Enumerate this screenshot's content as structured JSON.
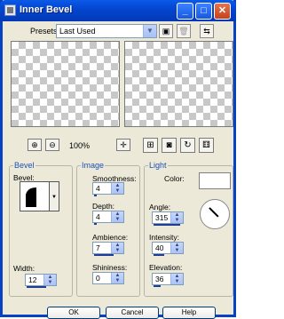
{
  "window": {
    "title": "Inner Bevel"
  },
  "title_buttons": {
    "minimize": "_",
    "maximize": "□",
    "close": "✕"
  },
  "presets": {
    "label": "Presets:",
    "value": "Last Used"
  },
  "zoom": {
    "in_icon": "zoom-in-icon",
    "out_icon": "zoom-out-icon",
    "level": "100%"
  },
  "bevel": {
    "group_title": "Bevel",
    "bevel_label": "Bevel:",
    "width_label": "Width:",
    "width_value": "12"
  },
  "image": {
    "group_title": "Image",
    "smoothness_label": "Smoothness:",
    "smoothness_value": "4",
    "depth_label": "Depth:",
    "depth_value": "4",
    "ambience_label": "Ambience:",
    "ambience_value": "7",
    "shininess_label": "Shininess:",
    "shininess_value": "0"
  },
  "light": {
    "group_title": "Light",
    "color_label": "Color:",
    "color_value": "#ffffff",
    "angle_label": "Angle:",
    "angle_value": "315",
    "intensity_label": "Intensity:",
    "intensity_value": "40",
    "elevation_label": "Elevation:",
    "elevation_value": "36"
  },
  "buttons": {
    "ok": "OK",
    "cancel": "Cancel",
    "help": "Help"
  },
  "colors": {
    "titlebar": "#0346d0",
    "group_title": "#1b4fb8",
    "accent_bar": "#1f3c96"
  }
}
